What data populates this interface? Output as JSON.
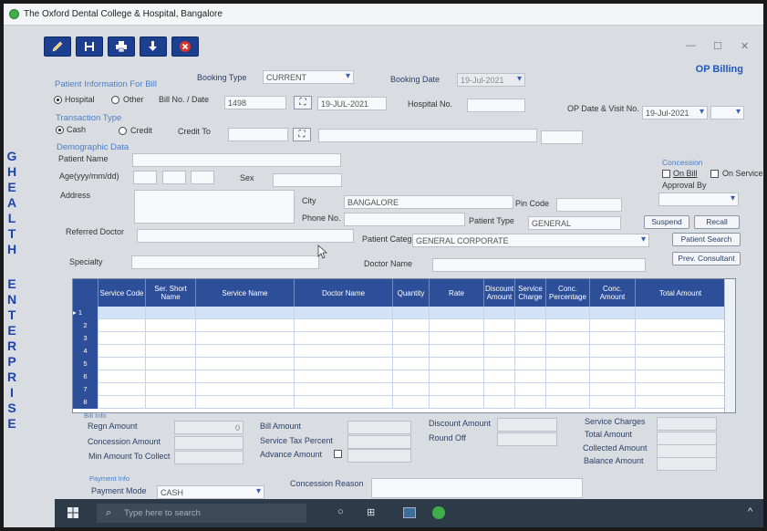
{
  "window": {
    "title": "The Oxford Dental College & Hospital, Bangalore",
    "module": "OP Billing"
  },
  "side_text": [
    "G",
    "H",
    "E",
    "A",
    "L",
    "T",
    "H",
    "E",
    "N",
    "T",
    "E",
    "R",
    "P",
    "R",
    "I",
    "S",
    "E"
  ],
  "toolbar": {
    "icons": [
      "pencil-icon",
      "save-icon",
      "print-icon",
      "import-icon",
      "close-icon"
    ]
  },
  "patient_info": {
    "section": "Patient Information For Bill",
    "booking_type_label": "Booking Type",
    "booking_type": "CURRENT",
    "booking_date_label": "Booking Date",
    "booking_date": "19-Jul-2021",
    "hospital_option": "Hospital",
    "other_option": "Other",
    "bill_no_label": "Bill No. / Date",
    "bill_no": "1498",
    "bill_date": "19-JUL-2021",
    "hospital_no_label": "Hospital No.",
    "op_date_label": "OP Date & Visit No.",
    "op_date": "19-Jul-2021"
  },
  "transaction": {
    "section": "Transaction Type",
    "cash": "Cash",
    "credit": "Credit",
    "credit_to_label": "Credit To"
  },
  "demographic": {
    "section": "Demographic Data",
    "patient_name_label": "Patient Name",
    "age_label": "Age(yyy/mm/dd)",
    "sex_label": "Sex",
    "address_label": "Address",
    "city_label": "City",
    "city": "BANGALORE",
    "pin_label": "Pin Code",
    "phone_label": "Phone No.",
    "patient_type_label": "Patient Type",
    "patient_type": "GENERAL",
    "referred_label": "Referred Doctor",
    "category_label": "Patient Category",
    "category": "GENERAL CORPORATE",
    "specialty_label": "Specialty",
    "doctor_label": "Doctor Name"
  },
  "concession": {
    "section": "Concession",
    "on_bill": "On Bill",
    "on_service": "On Service",
    "approval": "Approval By"
  },
  "actions": {
    "suspend": "Suspend",
    "recall": "Recall",
    "patient_search": "Patient Search",
    "prev_consultant": "Prev. Consultant"
  },
  "grid": {
    "columns": [
      "Service Code",
      "Ser. Short Name",
      "Service Name",
      "Doctor Name",
      "Quantity",
      "Rate",
      "Discount Amount",
      "Service Charge",
      "Conc. Percentage",
      "Conc. Amount",
      "Total Amount"
    ],
    "rows": [
      "1",
      "2",
      "3",
      "4",
      "5",
      "6",
      "7",
      "8"
    ]
  },
  "bill_info": {
    "section": "Bill Info",
    "regn_amount_label": "Regn Amount",
    "regn_amount": "0",
    "concession_amount_label": "Concession Amount",
    "min_amount_label": "Min Amount To Collect",
    "bill_amount_label": "Bill Amount",
    "service_tax_label": "Service Tax Percent",
    "advance_label": "Advance Amount",
    "discount_label": "Discount Amount",
    "round_off_label": "Round Off",
    "service_charges_label": "Service Charges",
    "total_amount_label": "Total Amount",
    "collected_label": "Collected Amount",
    "balance_label": "Balance Amount"
  },
  "payment": {
    "section": "Payment Info",
    "mode_label": "Payment Mode",
    "mode": "CASH",
    "reason_label": "Concession Reason"
  },
  "taskbar": {
    "search_placeholder": "Type here to search"
  }
}
